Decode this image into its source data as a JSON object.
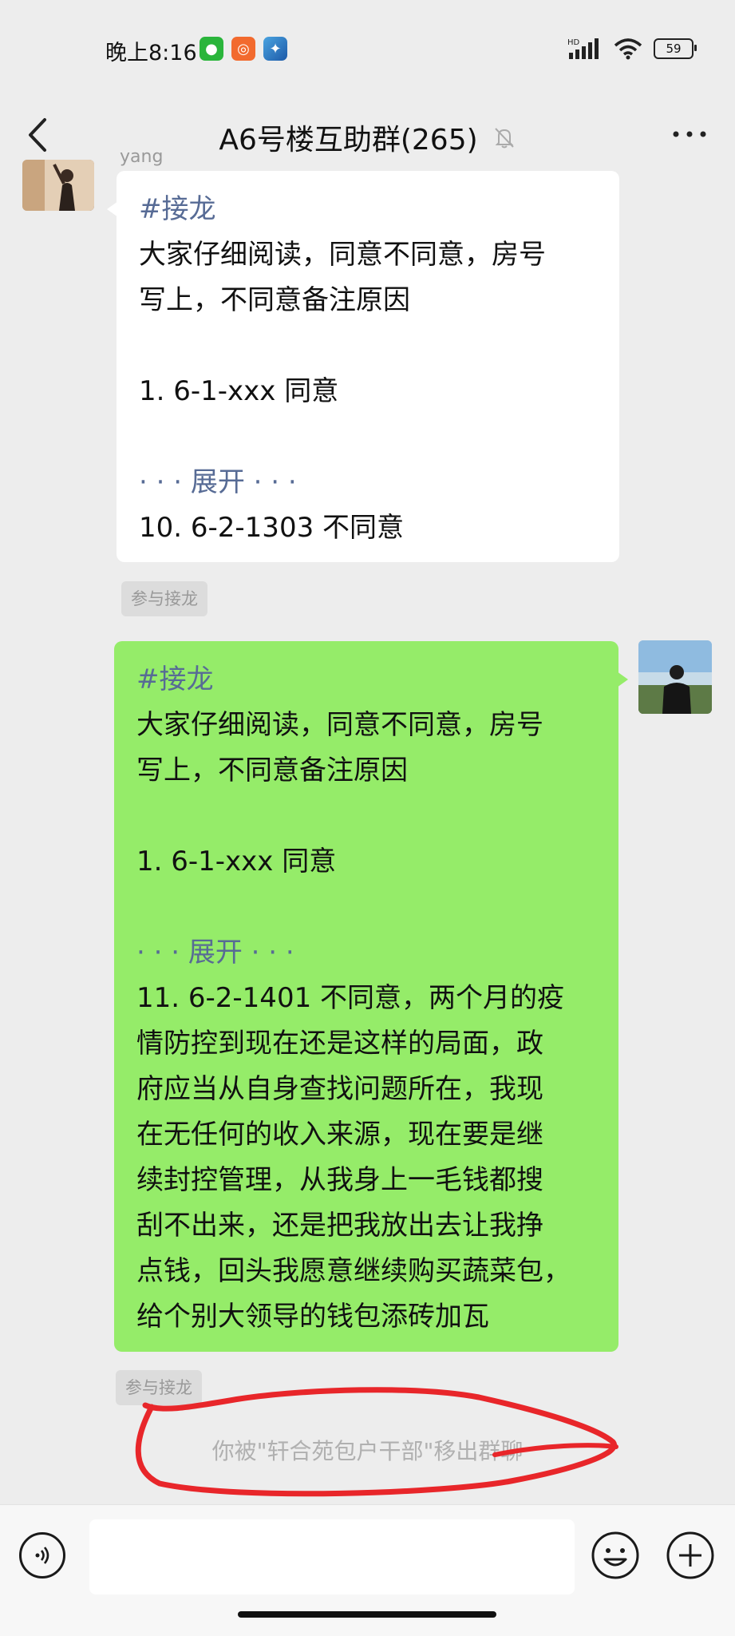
{
  "status_bar": {
    "time": "晚上8:16",
    "battery": "59",
    "network": "HD"
  },
  "header": {
    "title": "A6号楼互助群(265)"
  },
  "messages": {
    "incoming": {
      "sender": "yang",
      "hashtag": "#接龙",
      "line1": "大家仔细阅读，同意不同意，房号",
      "line2": "写上，不同意备注原因",
      "entry1": "1. 6-1-xxx 同意",
      "expand": "· · · 展开 · · ·",
      "entry_last": "10. 6-2-1303 不同意",
      "join_label": "参与接龙"
    },
    "outgoing": {
      "hashtag": "#接龙",
      "line1": "大家仔细阅读，同意不同意，房号",
      "line2": "写上，不同意备注原因",
      "entry1": "1. 6-1-xxx 同意",
      "expand": "· · · 展开 · · ·",
      "entry_lines": [
        "11. 6-2-1401 不同意，两个月的疫",
        "情防控到现在还是这样的局面，政",
        "府应当从自身查找问题所在，我现",
        "在无任何的收入来源，现在要是继",
        "续封控管理，从我身上一毛钱都搜",
        "刮不出来，还是把我放出去让我挣",
        "点钱，回头我愿意继续购买蔬菜包，",
        "给个别大领导的钱包添砖加瓦"
      ],
      "join_label": "参与接龙"
    },
    "system": "你被\"轩合苑包户干部\"移出群聊"
  },
  "input_bar": {
    "value": "",
    "placeholder": ""
  },
  "colors": {
    "background": "#ededed",
    "bubble_out": "#95ec69",
    "link": "#576b95",
    "annotation": "#e8262a"
  }
}
